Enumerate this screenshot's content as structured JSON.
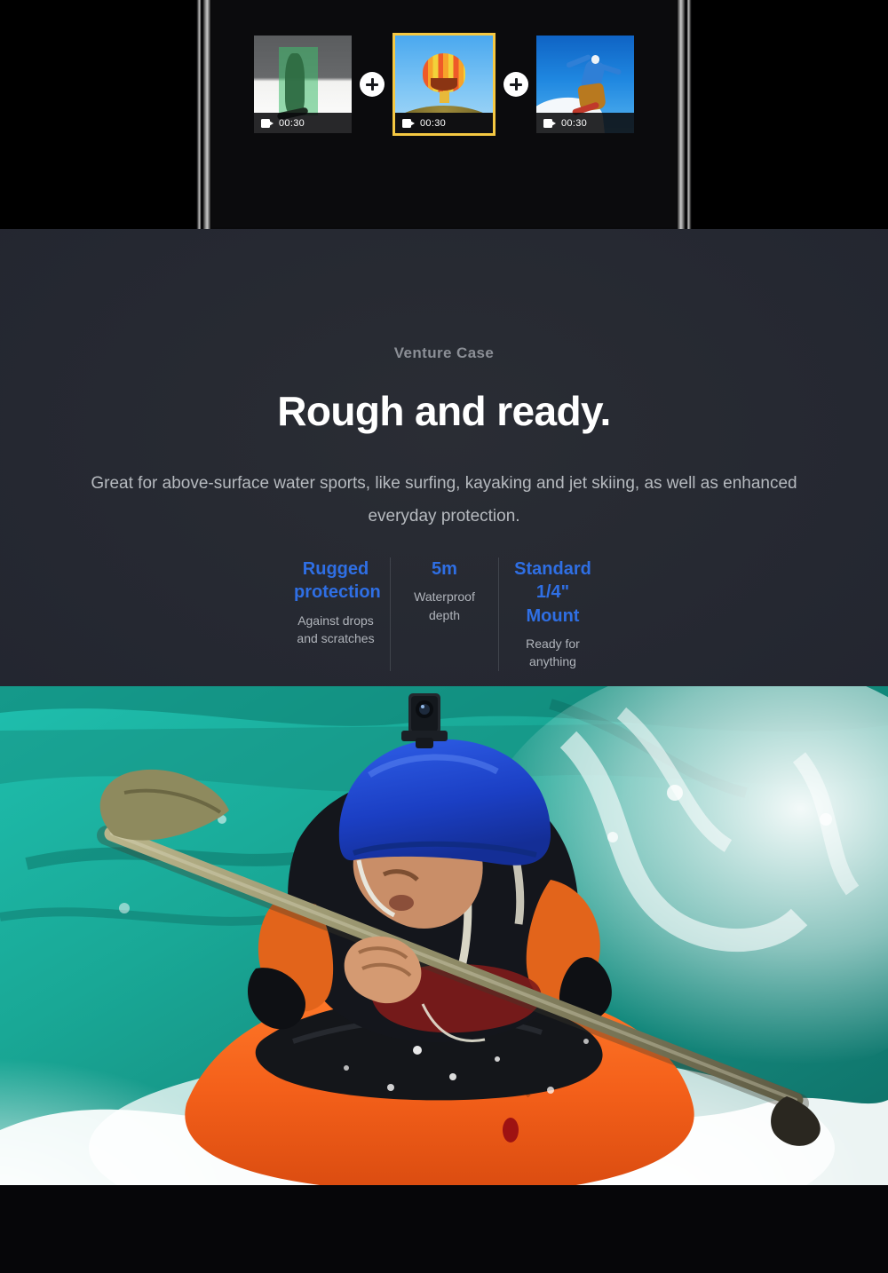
{
  "editor": {
    "clips": [
      {
        "duration": "00:30",
        "icon": "video-camera-icon",
        "art": "snowboarder-grayscale-with-green-selection",
        "selected": false
      },
      {
        "duration": "00:30",
        "icon": "video-camera-icon",
        "art": "hot-air-balloon-over-hill",
        "selected": true
      },
      {
        "duration": "00:30",
        "icon": "video-camera-icon",
        "art": "snowboarder-blue-sky-jump",
        "selected": false
      }
    ],
    "add_icon": "plus-circle-icon",
    "selected_border_color": "#f5c842"
  },
  "promo": {
    "eyebrow": "Venture Case",
    "headline": "Rough and ready.",
    "description": "Great for above-surface water sports, like surfing, kayaking and jet skiing, as well as enhanced everyday protection.",
    "accent_color": "#2f6fe4",
    "stats": [
      {
        "value": "Rugged protection",
        "caption": "Against drops and scratches"
      },
      {
        "value": "5m",
        "caption": "Waterproof depth"
      },
      {
        "value": "Standard 1/4\" Mount",
        "caption": "Ready for anything"
      }
    ]
  },
  "hero": {
    "alt": "kayaker-in-whitewater-with-action-camera-on-helmet"
  }
}
